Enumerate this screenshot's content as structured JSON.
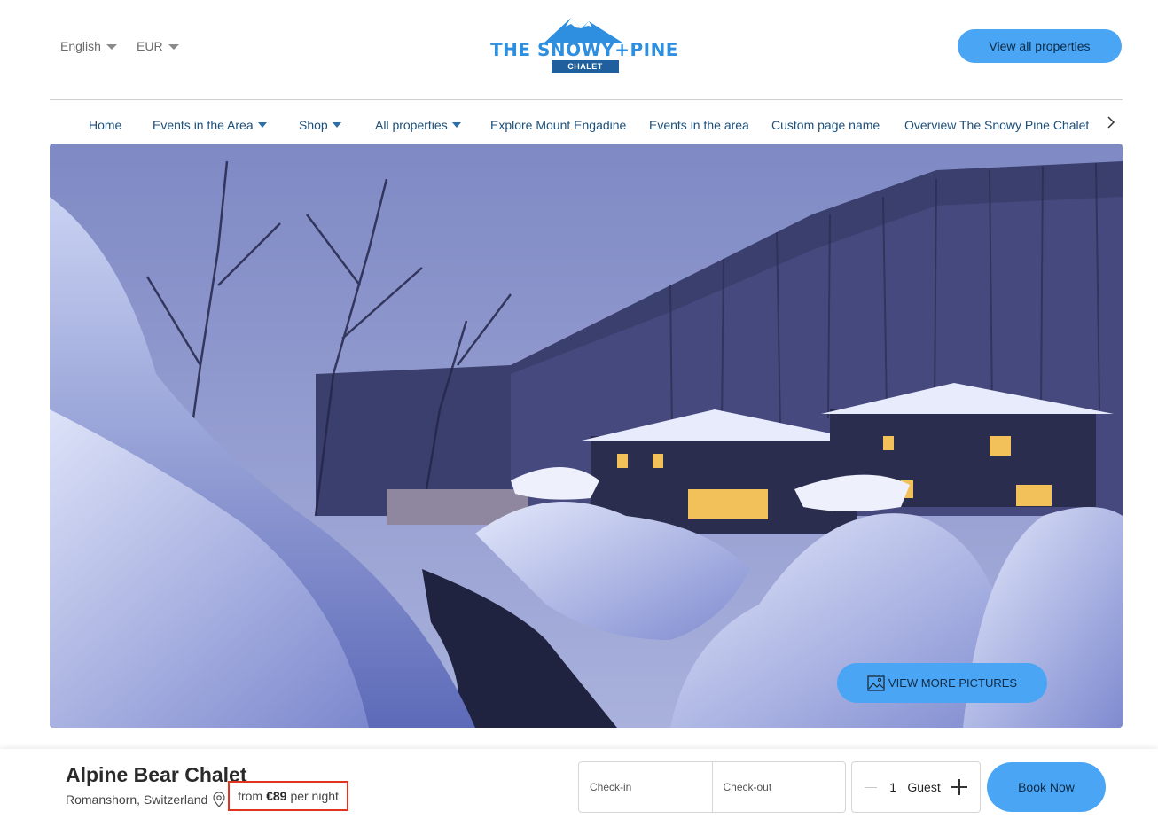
{
  "header": {
    "language": "English",
    "currency": "EUR",
    "logo": {
      "title": "THE SNOWY+PINE",
      "ribbon": "CHALET"
    },
    "view_all_label": "View all properties"
  },
  "nav": {
    "items": [
      {
        "label": "Home",
        "dropdown": false
      },
      {
        "label": "Events in the Area",
        "dropdown": true
      },
      {
        "label": "Shop",
        "dropdown": true
      },
      {
        "label": "All properties",
        "dropdown": true
      },
      {
        "label": "Explore Mount Engadine",
        "dropdown": false
      },
      {
        "label": "Events in the area",
        "dropdown": false
      },
      {
        "label": "Custom page name",
        "dropdown": false
      },
      {
        "label": "Overview The Snowy Pine Chalet",
        "dropdown": false
      }
    ],
    "next_icon": "chevron-right-icon"
  },
  "hero": {
    "image_icon": "image-icon",
    "more_pictures_label": "VIEW MORE PICTURES"
  },
  "booking": {
    "title": "Alpine Bear Chalet",
    "location": "Romanshorn, Switzerland",
    "location_icon": "map-pin-icon",
    "price_prefix": "from",
    "price": "€89",
    "price_suffix": "per night",
    "checkin_placeholder": "Check-in",
    "checkout_placeholder": "Check-out",
    "guest_count": "1",
    "guest_label": "Guest",
    "book_now_label": "Book Now"
  },
  "colors": {
    "accent": "#4aa6f5",
    "nav_text": "#1c4f7a",
    "highlight_border": "#e0341f"
  }
}
